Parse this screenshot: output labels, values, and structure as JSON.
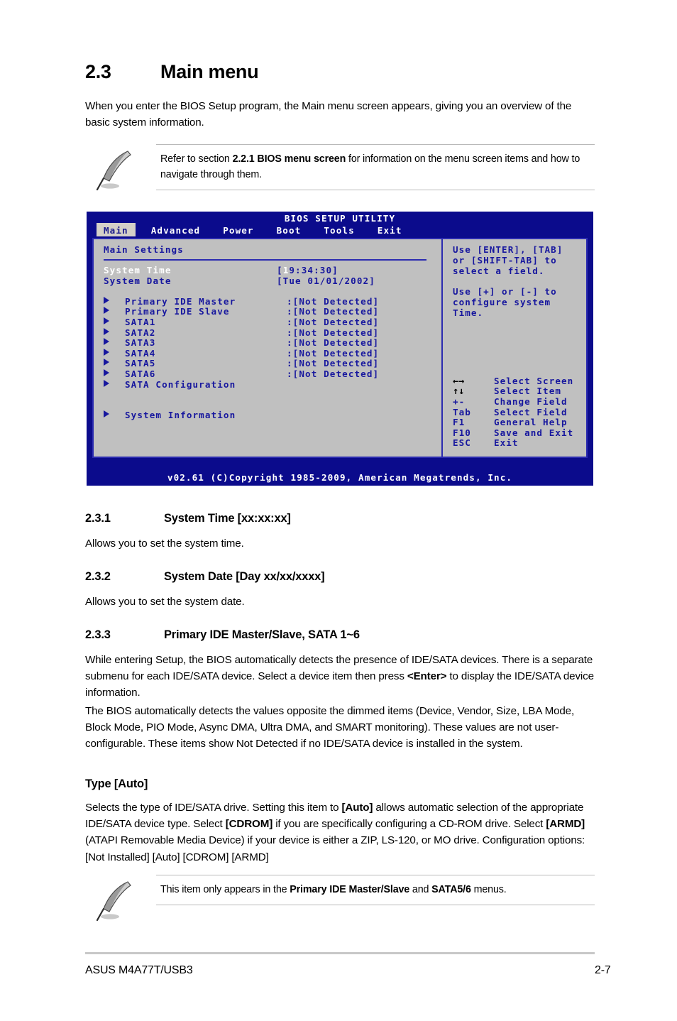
{
  "section": {
    "number": "2.3",
    "title": "Main menu",
    "intro": "When you enter the BIOS Setup program, the Main menu screen appears, giving you an overview of the basic system information."
  },
  "note_top": {
    "icon": "quill-pen-icon",
    "text_before": "Refer to section ",
    "bold_1": "2.2.1 BIOS menu screen",
    "text_after": " for information on the menu screen items and how to navigate through them."
  },
  "bios": {
    "title": "BIOS SETUP UTILITY",
    "tabs": [
      {
        "label": "Main",
        "active": true
      },
      {
        "label": "Advanced",
        "active": false
      },
      {
        "label": "Power",
        "active": false
      },
      {
        "label": "Boot",
        "active": false
      },
      {
        "label": "Tools",
        "active": false
      },
      {
        "label": "Exit",
        "active": false
      }
    ],
    "panel_title": "Main Settings",
    "fields": [
      {
        "label": "System Time",
        "value_prefix": "[",
        "value_hl": "1",
        "value_rest": "9:34:30]",
        "selected": true
      },
      {
        "label": "System Date",
        "value": "[Tue 01/01/2002]",
        "selected": false
      }
    ],
    "devices": [
      {
        "label": "Primary IDE Master",
        "value": ":[Not Detected]"
      },
      {
        "label": "Primary IDE Slave",
        "value": ":[Not Detected]"
      },
      {
        "label": "SATA1",
        "value": ":[Not Detected]"
      },
      {
        "label": "SATA2",
        "value": ":[Not Detected]"
      },
      {
        "label": "SATA3",
        "value": ":[Not Detected]"
      },
      {
        "label": "SATA4",
        "value": ":[Not Detected]"
      },
      {
        "label": "SATA5",
        "value": ":[Not Detected]"
      },
      {
        "label": "SATA6",
        "value": ":[Not Detected]"
      },
      {
        "label": "SATA Configuration",
        "value": ""
      }
    ],
    "submenus": [
      {
        "label": "System Information",
        "value": ""
      }
    ],
    "help_text": "Use [ENTER], [TAB]\nor [SHIFT-TAB] to\nselect a field.\n\nUse [+] or [-] to\nconfigure system\nTime.",
    "legend": [
      {
        "key": "←→",
        "glyph": true,
        "desc": "Select Screen"
      },
      {
        "key": "↑↓",
        "glyph": true,
        "desc": "Select Item"
      },
      {
        "key": "+-",
        "glyph": false,
        "desc": "Change Field"
      },
      {
        "key": "Tab",
        "glyph": false,
        "desc": "Select Field"
      },
      {
        "key": "F1",
        "glyph": false,
        "desc": "General Help"
      },
      {
        "key": "F10",
        "glyph": false,
        "desc": "Save and Exit"
      },
      {
        "key": "ESC",
        "glyph": false,
        "desc": "Exit"
      }
    ],
    "footer": "v02.61 (C)Copyright 1985-2009, American Megatrends, Inc."
  },
  "sub_231": {
    "number": "2.3.1",
    "title": "System Time [xx:xx:xx]",
    "body": "Allows you to set the system time."
  },
  "sub_232": {
    "number": "2.3.2",
    "title": "System Date [Day xx/xx/xxxx]",
    "body": "Allows you to set the system date."
  },
  "sub_233": {
    "number": "2.3.3",
    "title": "Primary IDE Master/Slave, SATA 1~6",
    "para1_a": "While entering Setup, the BIOS automatically detects the presence of IDE/SATA devices. There is a separate submenu for each IDE/SATA device. Select a device item then press ",
    "para1_bold": "<Enter>",
    "para1_b": " to display the IDE/SATA device information.",
    "para2": "The BIOS automatically detects the values opposite the dimmed items (Device, Vendor, Size, LBA Mode, Block Mode, PIO Mode, Async DMA, Ultra DMA, and SMART monitoring). These values are not user-configurable. These items show Not Detected if no IDE/SATA device is installed in the system."
  },
  "type_auto": {
    "heading": "Type [Auto]",
    "p_a": "Selects the type of IDE/SATA drive. Setting this item to ",
    "p_b1": "[Auto]",
    "p_c": " allows automatic selection of the appropriate IDE/SATA device type. Select ",
    "p_b2": "[CDROM]",
    "p_d": " if you are specifically configuring a CD-ROM drive. Select ",
    "p_b3": "[ARMD]",
    "p_e": " (ATAPI Removable Media Device) if your device is either a ZIP, LS-120, or MO drive. Configuration options: [Not Installed] [Auto] [CDROM] [ARMD]"
  },
  "note_bottom": {
    "icon": "quill-pen-icon",
    "text_before": "This item only appears in the ",
    "bold_1": "Primary IDE Master/Slave",
    "text_mid": " and ",
    "bold_2": "SATA5/6",
    "text_after": " menus."
  },
  "footer": {
    "left": "ASUS M4A77T/USB3",
    "right": "2-7"
  },
  "colors": {
    "bios_navy": "#0b0b8c",
    "bios_panel": "#c0c0c0",
    "bios_blue_text": "#17179e",
    "bios_tab_active_bg": "#d4d0c8",
    "rule_grey": "#b9b9b9"
  }
}
